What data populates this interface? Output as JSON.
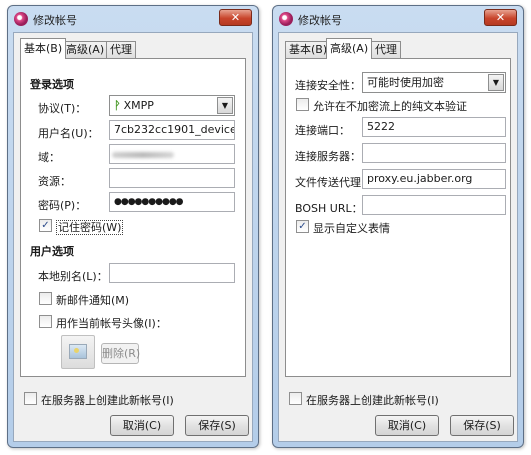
{
  "window_title": "修改帐号",
  "close_label": "✕",
  "tabs": [
    "基本(B)",
    "高级(A)",
    "代理"
  ],
  "basic": {
    "login_section": "登录选项",
    "protocol_label": "协议(T)：",
    "protocol_value": "XMPP",
    "username_label": "用户名(U)：",
    "username_value": "7cb232cc1901_device",
    "domain_label": "域：",
    "resource_label": "资源：",
    "password_label": "密码(P)：",
    "password_value": "●●●●●●●●●●",
    "remember_password_label": "记住密码(W)",
    "remember_password_checked": true,
    "user_section": "用户选项",
    "alias_label": "本地别名(L)：",
    "new_mail_label": "新邮件通知(M)",
    "buddy_icon_label": "用作当前帐号头像(I)：",
    "remove_label": "删除(R)"
  },
  "advanced": {
    "security_label": "连接安全性：",
    "security_value": "可能时使用加密",
    "plaintext_label": "允许在不加密流上的纯文本验证",
    "port_label": "连接端口：",
    "port_value": "5222",
    "server_label": "连接服务器：",
    "proxy_label": "文件传送代理：",
    "proxy_value": "proxy.eu.jabber.org",
    "bosh_label": "BOSH URL：",
    "custom_smileys_label": "显示自定义表情",
    "custom_smileys_checked": true
  },
  "footer": {
    "create_account_label": "在服务器上创建此新帐号(I)",
    "cancel_label": "取消(C)",
    "save_label": "保存(S)"
  }
}
